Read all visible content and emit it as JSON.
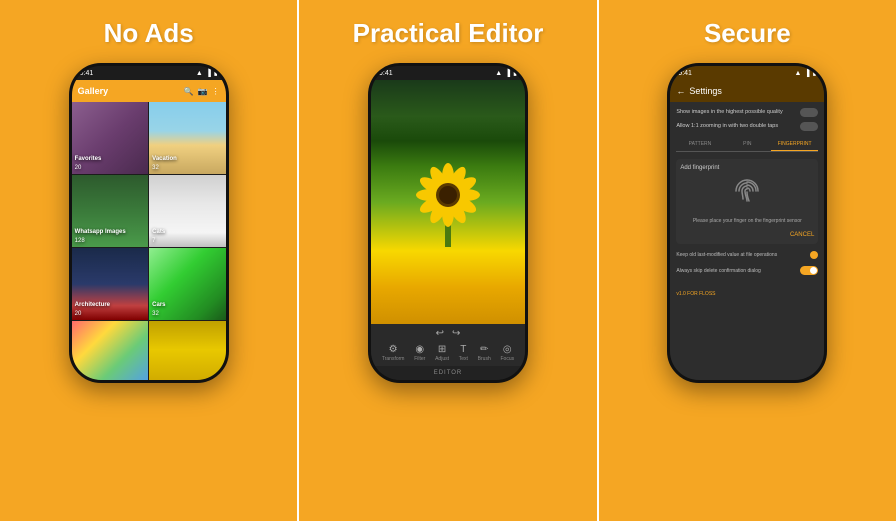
{
  "panels": [
    {
      "id": "no-ads",
      "title": "No Ads",
      "phone": {
        "status_time": "9:41",
        "app_bar_title": "Gallery",
        "gallery_items": [
          {
            "name": "Favorites",
            "count": "20",
            "photo": "person"
          },
          {
            "name": "Vacation",
            "count": "32",
            "photo": "beach"
          },
          {
            "name": "Whatsapp Images",
            "count": "128",
            "photo": "plants"
          },
          {
            "name": "Cats",
            "count": "7",
            "photo": "cat"
          },
          {
            "name": "Architecture",
            "count": "20",
            "photo": "architecture"
          },
          {
            "name": "Cars",
            "count": "32",
            "photo": "car"
          },
          {
            "name": "",
            "count": "",
            "photo": "colorful"
          },
          {
            "name": "",
            "count": "",
            "photo": "yellow"
          }
        ]
      }
    },
    {
      "id": "practical-editor",
      "title": "Practical Editor",
      "phone": {
        "status_time": "9:41",
        "tools": [
          {
            "icon": "⚙",
            "label": "Transform"
          },
          {
            "icon": "◉",
            "label": "Filter"
          },
          {
            "icon": "⊞",
            "label": "Adjust"
          },
          {
            "icon": "T",
            "label": "Text"
          },
          {
            "icon": "✏",
            "label": "Brush"
          },
          {
            "icon": "◎",
            "label": "Focus"
          }
        ],
        "bottom_label": "EDITOR",
        "undo_label": "↩",
        "redo_label": "↪"
      }
    },
    {
      "id": "secure",
      "title": "Secure",
      "phone": {
        "status_time": "9:41",
        "settings_title": "Settings",
        "row1": "Show images in the highest possible quality",
        "row2": "Allow 1:1 zooming in with two double taps",
        "tabs": [
          "PATTERN",
          "PIN",
          "FINGERPRINT"
        ],
        "active_tab": 2,
        "add_fingerprint_label": "Add fingerprint",
        "fingerprint_hint": "Please place your finger on the fingerprint sensor",
        "cancel_label": "CANCEL",
        "footer_row1": "Keep old last-modified value at file operations",
        "footer_row2": "Always skip delete confirmation dialog",
        "version_label": "v1.0 FOR FLOSS"
      }
    }
  ]
}
